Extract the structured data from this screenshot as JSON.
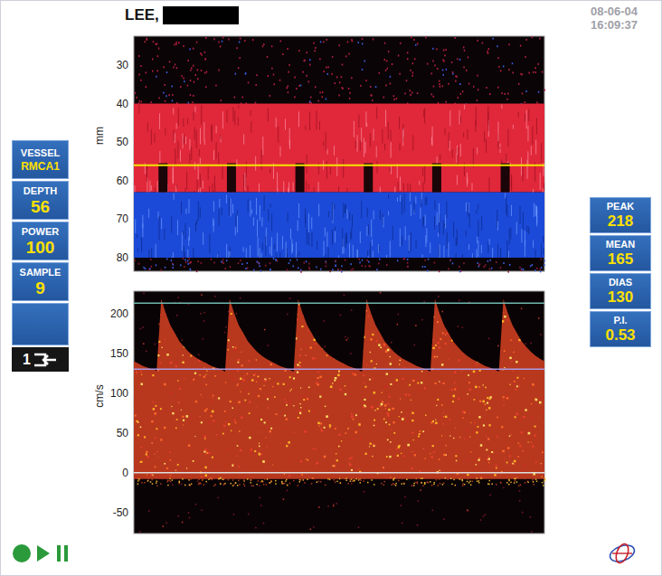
{
  "patient": {
    "name": "LEE,",
    "redacted": true
  },
  "timestamp": {
    "date": "08-06-04",
    "time": "16:09:37"
  },
  "settings": [
    {
      "label": "VESSEL",
      "value": "RMCA1"
    },
    {
      "label": "DEPTH",
      "value": "56"
    },
    {
      "label": "POWER",
      "value": "100"
    },
    {
      "label": "SAMPLE",
      "value": "9"
    }
  ],
  "probe": {
    "label": "1"
  },
  "measurements": [
    {
      "label": "PEAK",
      "value": "218"
    },
    {
      "label": "MEAN",
      "value": "165"
    },
    {
      "label": "DIAS",
      "value": "130"
    },
    {
      "label": "P.I.",
      "value": "0.53"
    }
  ],
  "mmode": {
    "axis_label": "mm",
    "ticks": [
      "30",
      "40",
      "50",
      "60",
      "70",
      "80"
    ],
    "gate_depth": 56,
    "bands": [
      {
        "name": "toward-probe",
        "from": 40,
        "to": 63,
        "color": "#e0283a"
      },
      {
        "name": "away-from-probe",
        "from": 63,
        "to": 80,
        "color": "#1c4ad8"
      }
    ]
  },
  "spectrum": {
    "axis_label": "cm/s",
    "ticks": [
      "200",
      "150",
      "100",
      "50",
      "0",
      "-50"
    ],
    "envelope": [
      140,
      137,
      134,
      132,
      130,
      128,
      218,
      200,
      185,
      175,
      165,
      158,
      152,
      147,
      143,
      140,
      137,
      134,
      132,
      130,
      127,
      218,
      200,
      185,
      175,
      165,
      158,
      152,
      147,
      143,
      140,
      137,
      134,
      132,
      130,
      127,
      218,
      200,
      185,
      175,
      165,
      158,
      152,
      147,
      143,
      140,
      137,
      134,
      132,
      130,
      127,
      218,
      200,
      185,
      175,
      165,
      158,
      152,
      147,
      143,
      140,
      137,
      134,
      132,
      130,
      127,
      218,
      200,
      185,
      175,
      165,
      158,
      152,
      147,
      143,
      140,
      137,
      134,
      132,
      130,
      127,
      218,
      200,
      185,
      175,
      165,
      158,
      152,
      147,
      143,
      140
    ],
    "max_line": 213,
    "dias_line": 130,
    "baseline": 0
  }
}
